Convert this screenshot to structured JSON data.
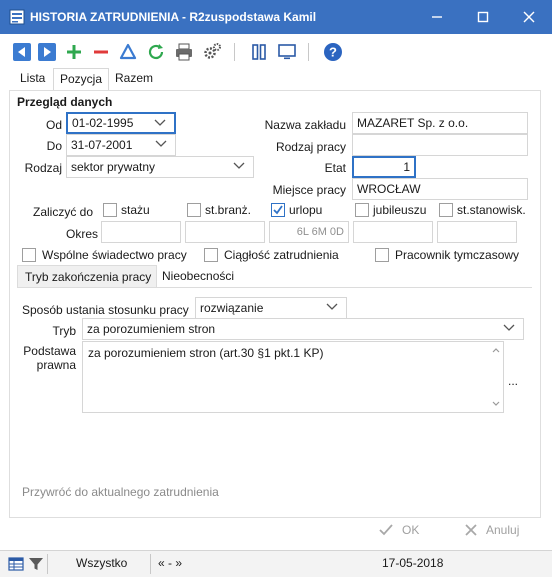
{
  "window": {
    "title": "HISTORIA ZATRUDNIENIA - R2zuspodstawa Kamil"
  },
  "tabs": [
    "Lista",
    "Pozycja",
    "Razem"
  ],
  "section": {
    "title": "Przegląd danych"
  },
  "fields": {
    "od": {
      "label": "Od",
      "value": "01-02-1995"
    },
    "do": {
      "label": "Do",
      "value": "31-07-2001"
    },
    "rodzaj": {
      "label": "Rodzaj",
      "value": "sektor prywatny"
    },
    "nazwa_zakladu": {
      "label": "Nazwa zakładu",
      "value": "MAZARET Sp. z o.o."
    },
    "rodzaj_pracy": {
      "label": "Rodzaj pracy",
      "value": ""
    },
    "etat": {
      "label": "Etat",
      "value": "1"
    },
    "miejsce_pracy": {
      "label": "Miejsce pracy",
      "value": "WROCŁAW"
    }
  },
  "zaliczyc": {
    "label": "Zaliczyć do",
    "items": [
      {
        "label": "stażu",
        "checked": false
      },
      {
        "label": "st.branż.",
        "checked": false
      },
      {
        "label": "urlopu",
        "checked": true
      },
      {
        "label": "jubileuszu",
        "checked": false
      },
      {
        "label": "st.stanowisk.",
        "checked": false
      }
    ]
  },
  "okres": {
    "label": "Okres",
    "values": [
      "",
      "",
      "6L 6M 0D",
      "",
      ""
    ]
  },
  "checks_row": [
    {
      "label": "Wspólne świadectwo pracy",
      "checked": false
    },
    {
      "label": "Ciągłość zatrudnienia",
      "checked": false
    },
    {
      "label": "Pracownik tymczasowy",
      "checked": false
    }
  ],
  "subtabs": [
    "Tryb zakończenia pracy",
    "Nieobecności"
  ],
  "zakonczenie": {
    "sposob_label": "Sposób ustania stosunku pracy",
    "sposob_value": "rozwiązanie",
    "tryb_label": "Tryb",
    "tryb_value": "za porozumieniem stron",
    "podstawa_label_1": "Podstawa",
    "podstawa_label_2": "prawna",
    "podstawa_value": "za porozumieniem stron (art.30 §1 pkt.1 KP)",
    "more_label": "..."
  },
  "restore_link": "Przywróć do aktualnego zatrudnienia",
  "buttons": {
    "ok": "OK",
    "cancel": "Anuluj"
  },
  "status": {
    "filter": "Wszystko",
    "nav": "« - »",
    "date": "17-05-2018"
  }
}
